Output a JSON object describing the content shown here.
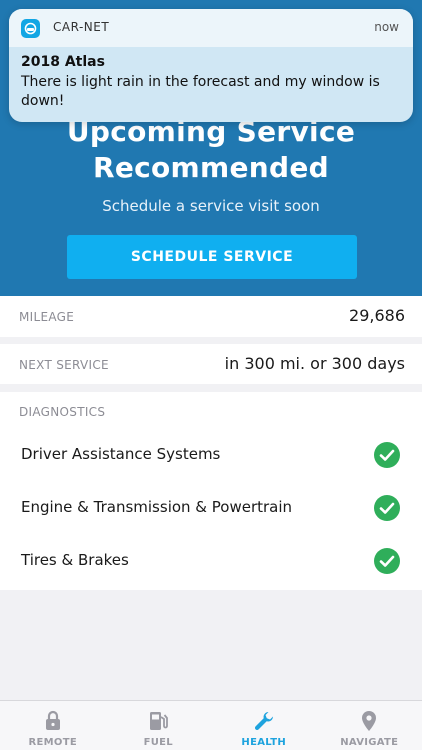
{
  "notification": {
    "app_name": "CAR-NET",
    "time": "now",
    "title": "2018 Atlas",
    "body": "There is light rain in the forecast and my window is down!"
  },
  "hero": {
    "title": "Upcoming Service Recommended",
    "subtitle": "Schedule a service visit soon",
    "button_label": "SCHEDULE SERVICE"
  },
  "mileage": {
    "label": "MILEAGE",
    "value": "29,686"
  },
  "next_service": {
    "label": "NEXT SERVICE",
    "value": "in 300 mi. or 300 days"
  },
  "diagnostics": {
    "header": "DIAGNOSTICS",
    "items": [
      {
        "label": "Driver Assistance Systems",
        "status_icon": "check-circle-icon"
      },
      {
        "label": "Engine & Transmission & Powertrain",
        "status_icon": "check-circle-icon"
      },
      {
        "label": "Tires & Brakes",
        "status_icon": "check-circle-icon"
      }
    ]
  },
  "tabbar": {
    "tabs": [
      {
        "label": "REMOTE",
        "icon": "lock-icon",
        "active": false
      },
      {
        "label": "FUEL",
        "icon": "fuel-pump-icon",
        "active": false
      },
      {
        "label": "HEALTH",
        "icon": "wrench-icon",
        "active": true
      },
      {
        "label": "NAVIGATE",
        "icon": "map-pin-icon",
        "active": false
      }
    ]
  },
  "colors": {
    "hero_bg": "#2078b1",
    "button_bg": "#10aff0",
    "status_ok": "#2fae5a",
    "tab_active": "#1ea3de",
    "tab_inactive": "#9b9ba3"
  }
}
